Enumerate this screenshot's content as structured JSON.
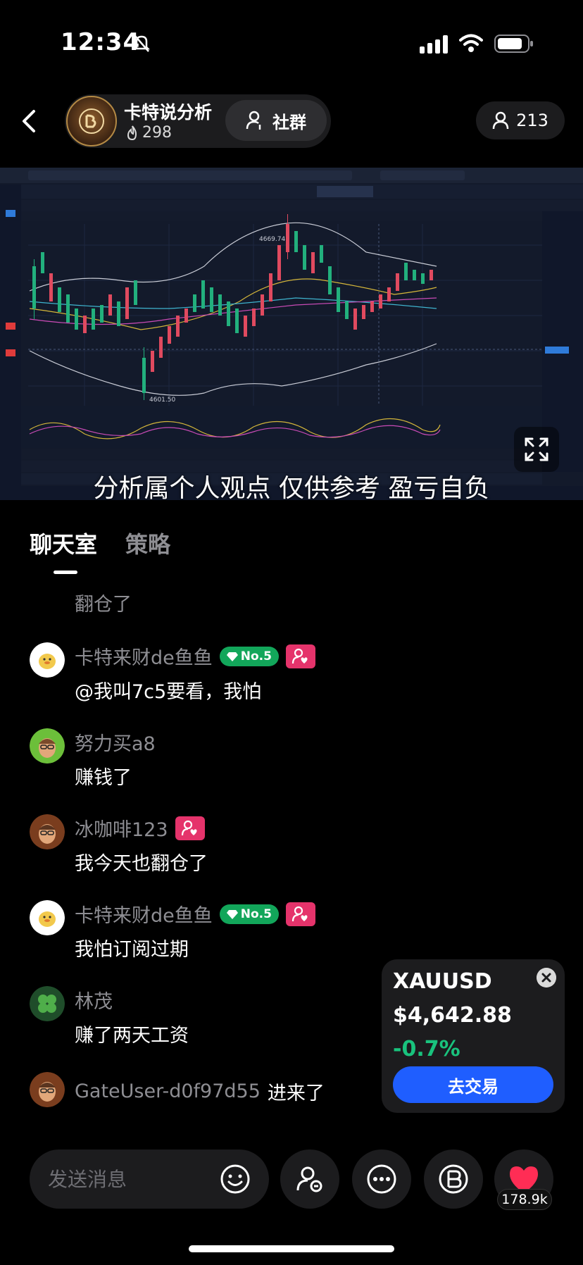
{
  "status_bar": {
    "time": "12:34"
  },
  "header": {
    "host_name": "卡特说分析",
    "host_logo_text": "卡特说分析",
    "heat": "298",
    "community_label": "社群",
    "viewers": "213"
  },
  "video": {
    "disclaimer": "分析属个人观点 仅供参考 盈亏自负",
    "chart_labels": {
      "high": "4669.74",
      "low": "4601.50"
    }
  },
  "tabs": [
    {
      "label": "聊天室",
      "active": true
    },
    {
      "label": "策略",
      "active": false
    }
  ],
  "chat": {
    "faded_message": "翻仓了",
    "messages": [
      {
        "user": "卡特来财de鱼鱼",
        "badge": "No.5",
        "fan_badge": true,
        "text": "@我叫7c5要看，我怕"
      },
      {
        "user": "努力买a8",
        "badge": "",
        "fan_badge": false,
        "text": "赚钱了"
      },
      {
        "user": "冰咖啡123",
        "badge": "",
        "fan_badge": true,
        "text": "我今天也翻仓了"
      },
      {
        "user": "卡特来财de鱼鱼",
        "badge": "No.5",
        "fan_badge": true,
        "text": "我怕订阅过期"
      },
      {
        "user": "林茂",
        "badge": "",
        "fan_badge": false,
        "text": "赚了两天工资"
      }
    ],
    "join_notice": {
      "user": "GateUser-d0f97d55",
      "text": "进来了"
    }
  },
  "price_card": {
    "symbol": "XAUUSD",
    "price": "$4,642.88",
    "change": "-0.7%",
    "trade_label": "去交易",
    "change_color": "#19c37d"
  },
  "bottom_bar": {
    "input_placeholder": "发送消息",
    "like_count": "178.9k"
  },
  "icons": [
    "back-icon",
    "flame-icon",
    "person-add-icon",
    "person-icon",
    "fullscreen-icon",
    "emoji-icon",
    "more-icon",
    "bitcoin-icon",
    "heart-icon"
  ]
}
